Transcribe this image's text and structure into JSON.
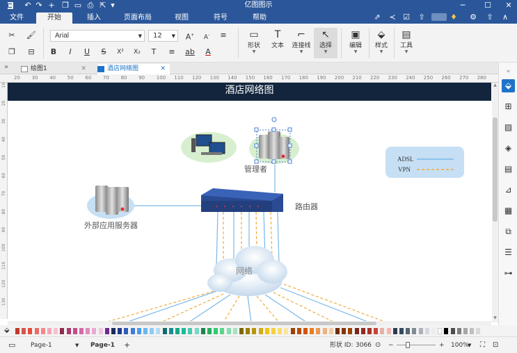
{
  "window": {
    "title": "亿图图示",
    "quick_access": [
      "↶",
      "↷",
      "+",
      "❐",
      "▭",
      "⎙",
      "⇱",
      "▾"
    ]
  },
  "menu": {
    "tabs": [
      "文件",
      "开始",
      "插入",
      "页面布局",
      "视图",
      "符号",
      "帮助"
    ],
    "active_tab": "开始",
    "right_icons": [
      "⇗",
      "≺",
      "☑",
      "⇧",
      "⚙",
      "∧"
    ]
  },
  "ribbon": {
    "font_name": "Arial",
    "font_size": "12",
    "tools": [
      {
        "label": "形状",
        "icon": "▭"
      },
      {
        "label": "文本",
        "icon": "T"
      },
      {
        "label": "连接线",
        "icon": "⌐"
      },
      {
        "label": "选择",
        "icon": "↖"
      },
      {
        "label": "编辑",
        "icon": "▣"
      },
      {
        "label": "样式",
        "icon": "⬙"
      },
      {
        "label": "工具",
        "icon": "▤"
      }
    ],
    "format_icons_row1": [
      "✂",
      "⌐",
      "A",
      "A",
      "≡"
    ],
    "format_icons_row2": [
      "❐",
      "⊟",
      "B",
      "I",
      "U",
      "S",
      "X²",
      "X₂",
      "T",
      "≡",
      "ab",
      "A"
    ]
  },
  "doc_tabs": [
    {
      "label": "绘图1",
      "active": false
    },
    {
      "label": "酒店网络图",
      "active": true
    }
  ],
  "ruler": {
    "h_ticks": [
      "20",
      "30",
      "40",
      "50",
      "60",
      "70",
      "80",
      "90",
      "100",
      "110",
      "120",
      "130",
      "140",
      "150",
      "160",
      "170",
      "180",
      "190",
      "200",
      "210",
      "220",
      "230",
      "240",
      "250",
      "260",
      "270",
      "280"
    ],
    "v_ticks": [
      "10",
      "20",
      "30",
      "40",
      "50",
      "60",
      "70",
      "80",
      "90",
      "100",
      "110",
      "120",
      "130"
    ]
  },
  "diagram": {
    "title": "酒店网络图",
    "labels": {
      "admin": "管理者",
      "router": "路由器",
      "external_server": "外部应用服务器",
      "network": "网络"
    },
    "legend": [
      {
        "label": "ADSL",
        "color": "#79b8e8",
        "style": "solid"
      },
      {
        "label": "VPN",
        "color": "#f2a93b",
        "style": "dashed"
      }
    ]
  },
  "palette_colors": [
    "#c0392b",
    "#d9534f",
    "#e74c3c",
    "#ec6b6b",
    "#f08a8a",
    "#f4a7b9",
    "#f7c1cf",
    "#8e2c4f",
    "#b03a6a",
    "#c74b8b",
    "#d66aa6",
    "#e08bbf",
    "#eaa9d1",
    "#f1c5e1",
    "#6a2c91",
    "#1a2c5b",
    "#1f3c88",
    "#2e5cb8",
    "#3b7dd8",
    "#4c9be8",
    "#6bb7f0",
    "#8fcaf4",
    "#b3dcf7",
    "#0f6b6b",
    "#138f8f",
    "#17a589",
    "#1abc9c",
    "#48c9b0",
    "#76d7c4",
    "#1e8449",
    "#27ae60",
    "#2ecc71",
    "#58d68d",
    "#82e0aa",
    "#a9dfbf",
    "#7d6608",
    "#9a7d0a",
    "#b7950b",
    "#d4ac0d",
    "#f1c40f",
    "#f4d03f",
    "#f7dc6f",
    "#f9e79f",
    "#a04000",
    "#ba4a00",
    "#d35400",
    "#e67e22",
    "#eb984e",
    "#f0b27a",
    "#f5cba7",
    "#6e2c00",
    "#873600",
    "#a04000",
    "#7b241c",
    "#922b21",
    "#a93226",
    "#cb4335",
    "#e6b0aa",
    "#f5b7b1",
    "#2c3e50",
    "#34495e",
    "#566573",
    "#808b96",
    "#abb2b9",
    "#d5d8dc",
    "#ebedef",
    "#ffffff",
    "#000000",
    "#4d4d4d",
    "#7f7f7f",
    "#a6a6a6",
    "#bfbfbf",
    "#d9d9d9"
  ],
  "status": {
    "page_dropdown": "Page-1",
    "page_tab": "Page-1",
    "add_page": "+",
    "shape_id_label": "形状 ID:",
    "shape_id": "3066",
    "zoom": "100%"
  }
}
